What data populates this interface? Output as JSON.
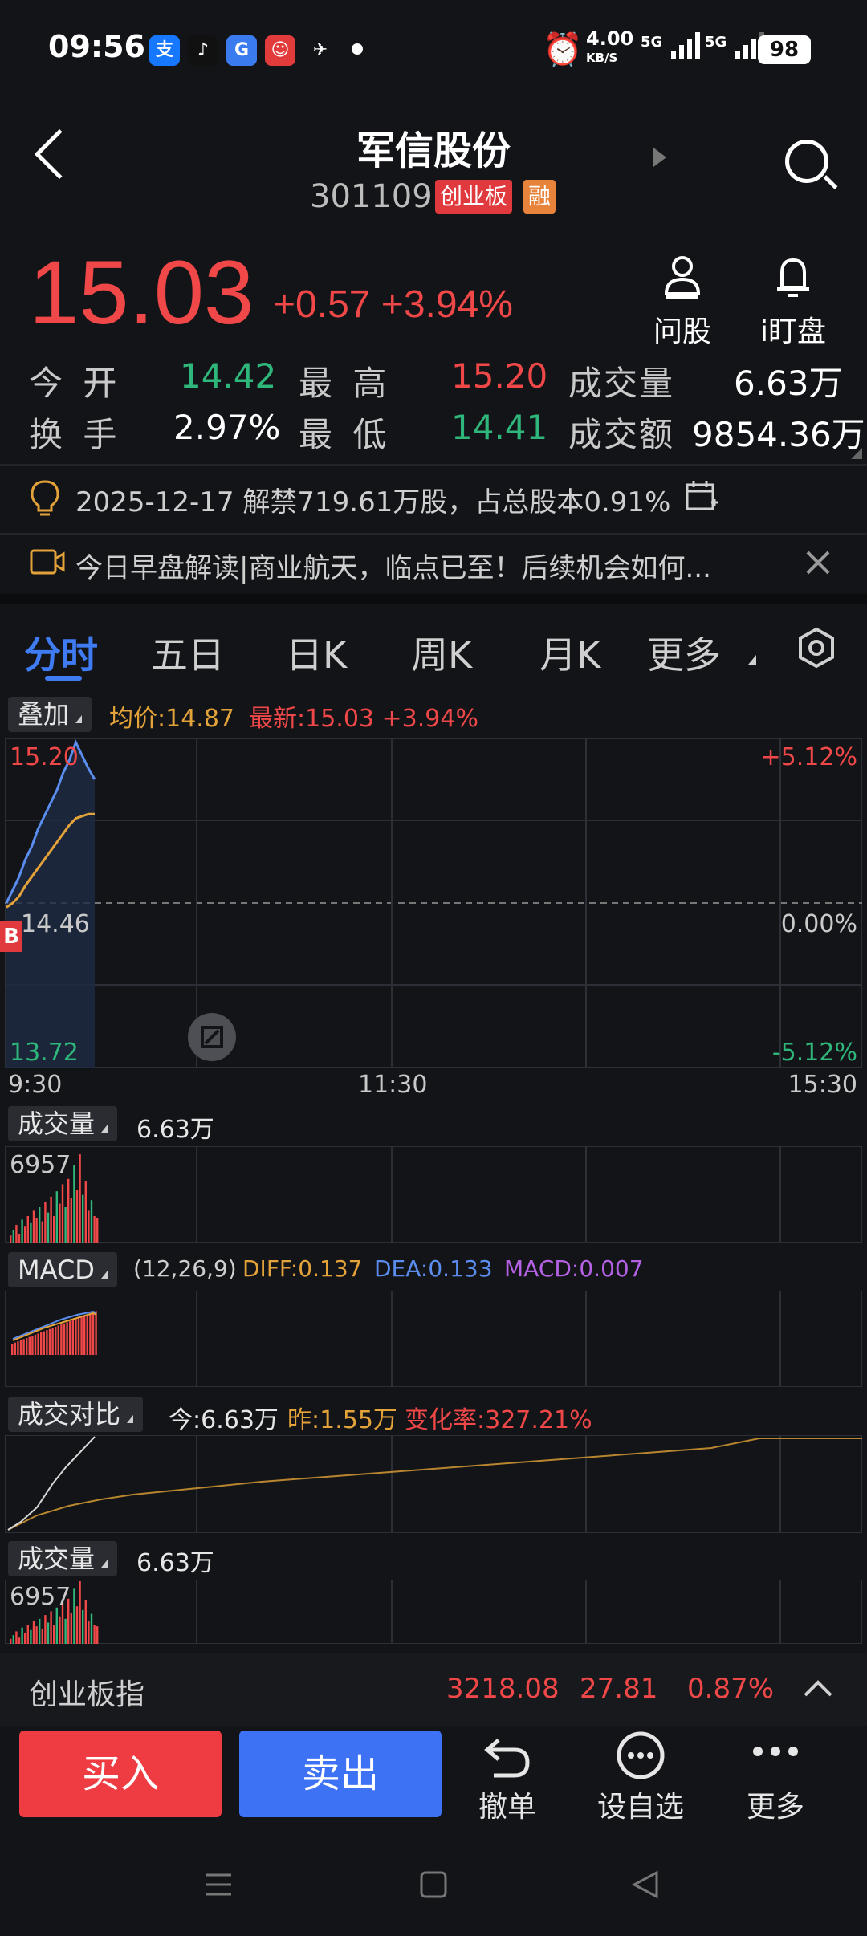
{
  "status": {
    "time": "09:56",
    "net_speed": "4.00",
    "net_unit": "KB/S",
    "signal1": "5G",
    "signal2": "5G",
    "battery": "98"
  },
  "header": {
    "title": "军信股份",
    "code": "301109",
    "badge_board": "创业板",
    "badge_margin": "融"
  },
  "quote": {
    "price": "15.03",
    "change": "+0.57",
    "change_pct": "+3.94%",
    "ask_label": "问股",
    "watch_label": "i盯盘"
  },
  "stats": {
    "open_label": "今 开",
    "open": "14.42",
    "high_label": "最 高",
    "high": "15.20",
    "volume_label": "成交量",
    "volume": "6.63万",
    "turnover_label": "换 手",
    "turnover": "2.97%",
    "low_label": "最 低",
    "low": "14.41",
    "amount_label": "成交额",
    "amount": "9854.36万"
  },
  "notices": {
    "unlock": "2025-12-17 解禁719.61万股，占总股本0.91%",
    "video": "今日早盘解读|商业航天，临点已至！后续机会如何..."
  },
  "tabs": [
    {
      "label": "分时"
    },
    {
      "label": "五日"
    },
    {
      "label": "日K"
    },
    {
      "label": "周K"
    },
    {
      "label": "月K"
    },
    {
      "label": "更多"
    }
  ],
  "intraday": {
    "overlay_label": "叠加",
    "avg_label": "均价:14.87",
    "latest_label": "最新:15.03 +3.94%",
    "y_high": "15.20",
    "y_mid": "14.46",
    "y_low": "13.72",
    "pct_high": "+5.12%",
    "pct_mid": "0.00%",
    "pct_low": "-5.12%",
    "t_start": "9:30",
    "t_mid": "11:30",
    "t_end": "15:30",
    "b_marker": "B"
  },
  "volume_panel": {
    "label": "成交量",
    "value": "6.63万",
    "max": "6957"
  },
  "macd_panel": {
    "label": "MACD",
    "params": "(12,26,9)",
    "diff": "DIFF:0.137",
    "dea": "DEA:0.133",
    "macd": "MACD:0.007"
  },
  "compare_panel": {
    "label": "成交对比",
    "today": "今:6.63万",
    "yesterday": "昨:1.55万",
    "rate": "变化率:327.21%"
  },
  "volume_panel2": {
    "label": "成交量",
    "value": "6.63万",
    "max": "6957"
  },
  "index_bar": {
    "name": "创业板指",
    "value": "3218.08",
    "change": "27.81",
    "pct": "0.87%"
  },
  "actions": {
    "buy": "买入",
    "sell": "卖出",
    "cancel": "撤单",
    "watchlist": "设自选",
    "more": "更多"
  },
  "colors": {
    "up": "#f04848",
    "down": "#2fb67a",
    "avg": "#e4a23a",
    "price_line": "#5b8def",
    "buy": "#ef3b42",
    "sell": "#3d72f5"
  },
  "chart_data": {
    "type": "line",
    "title": "",
    "xlabel": "",
    "ylabel": "",
    "ylim": [
      13.72,
      15.2
    ],
    "x_ticks": [
      "9:30",
      "11:30",
      "15:30"
    ],
    "series": [
      {
        "values": [
          14.46,
          14.52,
          14.58,
          14.66,
          14.72,
          14.8,
          14.86,
          14.92,
          14.98,
          15.06,
          15.12,
          15.2,
          15.14,
          15.08,
          15.03
        ]
      },
      {
        "values": [
          14.44,
          14.46,
          14.49,
          14.54,
          14.58,
          14.62,
          14.66,
          14.7,
          14.74,
          14.78,
          14.82,
          14.85,
          14.86,
          14.87,
          14.87
        ]
      }
    ]
  }
}
